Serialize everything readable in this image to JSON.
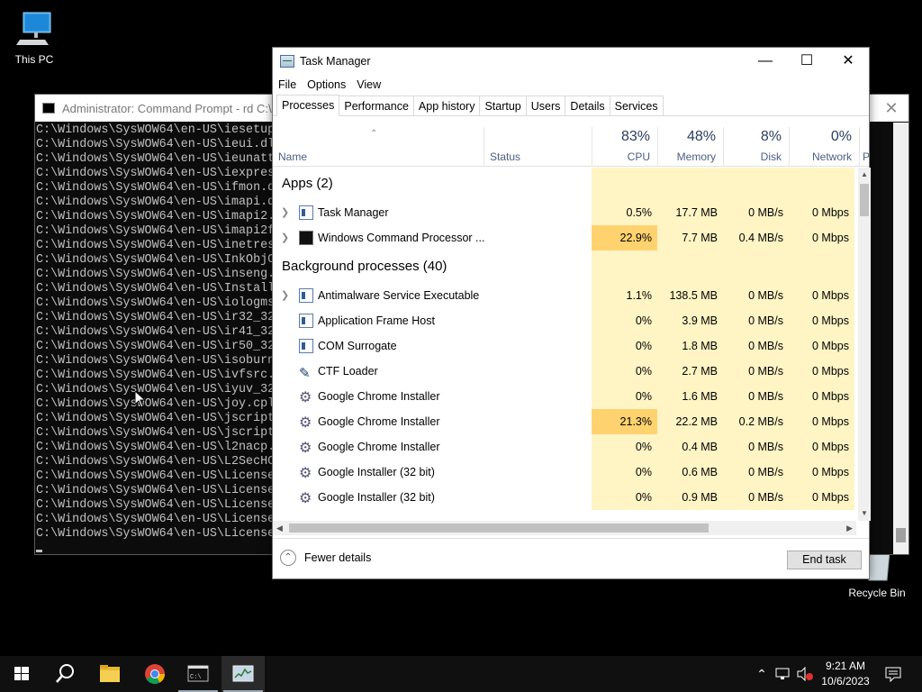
{
  "desktop": {
    "this_pc_label": "This PC",
    "recycle_bin_label": "Recycle Bin"
  },
  "cmd": {
    "title": "Administrator: Command Prompt - rd  C:\\/S",
    "lines": [
      "C:\\Windows\\SysWOW64\\en-US\\iesetup",
      "C:\\Windows\\SysWOW64\\en-US\\ieui.dl",
      "C:\\Windows\\SysWOW64\\en-US\\ieunatt",
      "C:\\Windows\\SysWOW64\\en-US\\iexpres",
      "C:\\Windows\\SysWOW64\\en-US\\ifmon.d",
      "C:\\Windows\\SysWOW64\\en-US\\imapi.d",
      "C:\\Windows\\SysWOW64\\en-US\\imapi2.",
      "C:\\Windows\\SysWOW64\\en-US\\imapi2f",
      "C:\\Windows\\SysWOW64\\en-US\\inetres",
      "C:\\Windows\\SysWOW64\\en-US\\InkObjC",
      "C:\\Windows\\SysWOW64\\en-US\\inseng.",
      "C:\\Windows\\SysWOW64\\en-US\\Install",
      "C:\\Windows\\SysWOW64\\en-US\\iologms",
      "C:\\Windows\\SysWOW64\\en-US\\ir32_32",
      "C:\\Windows\\SysWOW64\\en-US\\ir41_32",
      "C:\\Windows\\SysWOW64\\en-US\\ir50_32",
      "C:\\Windows\\SysWOW64\\en-US\\isoburn",
      "C:\\Windows\\SysWOW64\\en-US\\ivfsrc.",
      "C:\\Windows\\SysWOW64\\en-US\\iyuv_32",
      "C:\\Windows\\SysWOW64\\en-US\\joy.cpl",
      "C:\\Windows\\SysWOW64\\en-US\\jscript",
      "C:\\Windows\\SysWOW64\\en-US\\jscript",
      "C:\\Windows\\SysWOW64\\en-US\\l2nacp.",
      "C:\\Windows\\SysWOW64\\en-US\\L2SecHC",
      "C:\\Windows\\SysWOW64\\en-US\\License",
      "C:\\Windows\\SysWOW64\\en-US\\License",
      "C:\\Windows\\SysWOW64\\en-US\\License",
      "C:\\Windows\\SysWOW64\\en-US\\License",
      "C:\\Windows\\SysWOW64\\en-US\\License"
    ]
  },
  "task_manager": {
    "title": "Task Manager",
    "menu": [
      "File",
      "Options",
      "View"
    ],
    "tabs": [
      "Processes",
      "Performance",
      "App history",
      "Startup",
      "Users",
      "Details",
      "Services"
    ],
    "columns": {
      "name": "Name",
      "status": "Status",
      "cpu": {
        "pct": "83%",
        "label": "CPU"
      },
      "memory": {
        "pct": "48%",
        "label": "Memory"
      },
      "disk": {
        "pct": "8%",
        "label": "Disk"
      },
      "network": {
        "pct": "0%",
        "label": "Network"
      },
      "power_partial": "P"
    },
    "groups": {
      "apps": "Apps (2)",
      "background": "Background processes (40)"
    },
    "apps": [
      {
        "name": "Task Manager",
        "icon": "task-manager-icon",
        "cpu": "0.5%",
        "mem": "17.7 MB",
        "disk": "0 MB/s",
        "net": "0 Mbps"
      },
      {
        "name": "Windows Command Processor ...",
        "icon": "cmd-icon",
        "cpu": "22.9%",
        "mem": "7.7 MB",
        "disk": "0.4 MB/s",
        "net": "0 Mbps"
      }
    ],
    "background": [
      {
        "name": "Antimalware Service Executable",
        "icon": "service-icon",
        "cpu": "1.1%",
        "mem": "138.5 MB",
        "disk": "0 MB/s",
        "net": "0 Mbps"
      },
      {
        "name": "Application Frame Host",
        "icon": "app-icon",
        "cpu": "0%",
        "mem": "3.9 MB",
        "disk": "0 MB/s",
        "net": "0 Mbps"
      },
      {
        "name": "COM Surrogate",
        "icon": "app-icon",
        "cpu": "0%",
        "mem": "1.8 MB",
        "disk": "0 MB/s",
        "net": "0 Mbps"
      },
      {
        "name": "CTF Loader",
        "icon": "pen-icon",
        "cpu": "0%",
        "mem": "2.7 MB",
        "disk": "0 MB/s",
        "net": "0 Mbps"
      },
      {
        "name": "Google Chrome Installer",
        "icon": "installer-icon",
        "cpu": "0%",
        "mem": "1.6 MB",
        "disk": "0 MB/s",
        "net": "0 Mbps"
      },
      {
        "name": "Google Chrome Installer",
        "icon": "installer-icon",
        "cpu": "21.3%",
        "mem": "22.2 MB",
        "disk": "0.2 MB/s",
        "net": "0 Mbps"
      },
      {
        "name": "Google Chrome Installer",
        "icon": "installer-icon",
        "cpu": "0%",
        "mem": "0.4 MB",
        "disk": "0 MB/s",
        "net": "0 Mbps"
      },
      {
        "name": "Google Installer (32 bit)",
        "icon": "installer-icon",
        "cpu": "0%",
        "mem": "0.6 MB",
        "disk": "0 MB/s",
        "net": "0 Mbps"
      },
      {
        "name": "Google Installer (32 bit)",
        "icon": "installer-icon",
        "cpu": "0%",
        "mem": "0.9 MB",
        "disk": "0 MB/s",
        "net": "0 Mbps"
      }
    ],
    "footer": {
      "fewer_details": "Fewer details",
      "end_task": "End task"
    },
    "colors": {
      "heat_low": "#fff4c4",
      "heat_mid": "#ffe8a8",
      "heat_high": "#ffd270",
      "group_text": "#1c5ba8"
    }
  },
  "taskbar": {
    "items": [
      "start-icon",
      "search-icon",
      "file-explorer-icon",
      "chrome-icon",
      "command-prompt-icon",
      "task-manager-icon"
    ],
    "time": "9:21 AM",
    "date": "10/6/2023",
    "tray": [
      "chevron-up-icon",
      "network-icon",
      "volume-muted-icon",
      "notification-icon"
    ]
  }
}
